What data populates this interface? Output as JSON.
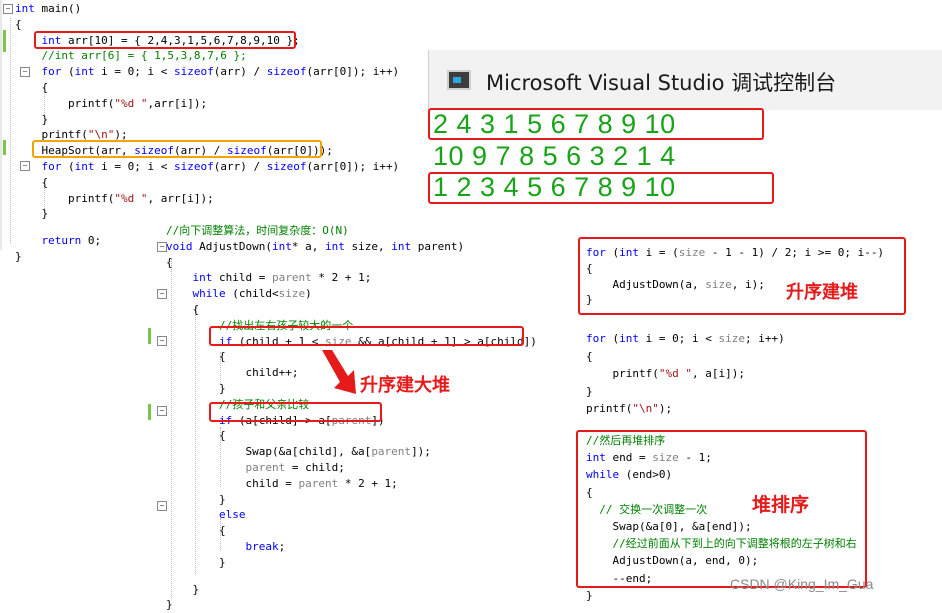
{
  "main_code": {
    "lines": [
      {
        "parts": [
          {
            "t": "int",
            "c": "kw"
          },
          {
            "t": " main()"
          }
        ]
      },
      {
        "parts": [
          {
            "t": "{"
          }
        ]
      },
      {
        "parts": [
          {
            "t": "    "
          },
          {
            "t": "int",
            "c": "kw"
          },
          {
            "t": " arr[10] = { 2,4,3,1,5,6,7,8,9,10 };"
          }
        ]
      },
      {
        "parts": [
          {
            "t": "    "
          },
          {
            "t": "//int arr[6] = { 1,5,3,8,7,6 };",
            "c": "cm"
          }
        ]
      },
      {
        "parts": [
          {
            "t": "    "
          },
          {
            "t": "for",
            "c": "kw"
          },
          {
            "t": " ("
          },
          {
            "t": "int",
            "c": "kw"
          },
          {
            "t": " i = 0; i < "
          },
          {
            "t": "sizeof",
            "c": "kw"
          },
          {
            "t": "(arr) / "
          },
          {
            "t": "sizeof",
            "c": "kw"
          },
          {
            "t": "(arr[0]); i++)"
          }
        ]
      },
      {
        "parts": [
          {
            "t": "    {"
          }
        ]
      },
      {
        "parts": [
          {
            "t": "        printf("
          },
          {
            "t": "\"%d \"",
            "c": "st"
          },
          {
            "t": ",arr[i]);"
          }
        ]
      },
      {
        "parts": [
          {
            "t": "    }"
          }
        ]
      },
      {
        "parts": [
          {
            "t": "    printf("
          },
          {
            "t": "\"\\n\"",
            "c": "st"
          },
          {
            "t": ");"
          }
        ]
      },
      {
        "parts": [
          {
            "t": "    HeapSort(arr, "
          },
          {
            "t": "sizeof",
            "c": "kw"
          },
          {
            "t": "(arr) / "
          },
          {
            "t": "sizeof",
            "c": "kw"
          },
          {
            "t": "(arr[0]));"
          }
        ]
      },
      {
        "parts": [
          {
            "t": "    "
          },
          {
            "t": "for",
            "c": "kw"
          },
          {
            "t": " ("
          },
          {
            "t": "int",
            "c": "kw"
          },
          {
            "t": " i = 0; i < "
          },
          {
            "t": "sizeof",
            "c": "kw"
          },
          {
            "t": "(arr) / "
          },
          {
            "t": "sizeof",
            "c": "kw"
          },
          {
            "t": "(arr[0]); i++)"
          }
        ]
      },
      {
        "parts": [
          {
            "t": "    {"
          }
        ]
      },
      {
        "parts": [
          {
            "t": "        printf("
          },
          {
            "t": "\"%d \"",
            "c": "st"
          },
          {
            "t": ", arr[i]);"
          }
        ]
      },
      {
        "parts": [
          {
            "t": "    }"
          }
        ]
      },
      {
        "parts": [
          {
            "t": ""
          }
        ]
      },
      {
        "parts": [
          {
            "t": "    "
          },
          {
            "t": "return",
            "c": "kw"
          },
          {
            "t": " 0;"
          }
        ]
      },
      {
        "parts": [
          {
            "t": "}"
          }
        ]
      }
    ]
  },
  "console": {
    "title": "Microsoft Visual Studio 调试控制台",
    "lines": [
      "2 4 3 1 5 6 7 8 9 10",
      "10 9 7 8 5 6 3 2 1 4",
      "1 2 3 4 5 6 7 8 9 10"
    ]
  },
  "adjust_code": {
    "lines": [
      {
        "parts": [
          {
            "t": "//向下调整算法，时间复杂度：O(N)",
            "c": "cm"
          }
        ]
      },
      {
        "parts": [
          {
            "t": "void",
            "c": "kw"
          },
          {
            "t": " AdjustDown("
          },
          {
            "t": "int",
            "c": "kw"
          },
          {
            "t": "* a, "
          },
          {
            "t": "int",
            "c": "kw"
          },
          {
            "t": " size, "
          },
          {
            "t": "int",
            "c": "kw"
          },
          {
            "t": " parent)"
          }
        ]
      },
      {
        "parts": [
          {
            "t": "{"
          }
        ]
      },
      {
        "parts": [
          {
            "t": "    "
          },
          {
            "t": "int",
            "c": "kw"
          },
          {
            "t": " child = "
          },
          {
            "t": "parent",
            "c": "pa"
          },
          {
            "t": " * 2 + 1;"
          }
        ]
      },
      {
        "parts": [
          {
            "t": "    "
          },
          {
            "t": "while",
            "c": "kw"
          },
          {
            "t": " (child<"
          },
          {
            "t": "size",
            "c": "pa"
          },
          {
            "t": ")"
          }
        ]
      },
      {
        "parts": [
          {
            "t": "    {"
          }
        ]
      },
      {
        "parts": [
          {
            "t": "        "
          },
          {
            "t": "//找出左右孩子较大的一个",
            "c": "cm"
          }
        ]
      },
      {
        "parts": [
          {
            "t": "        "
          },
          {
            "t": "if",
            "c": "kw"
          },
          {
            "t": " (child + 1 < "
          },
          {
            "t": "size",
            "c": "pa"
          },
          {
            "t": " && a[child + 1] > a[child])"
          }
        ]
      },
      {
        "parts": [
          {
            "t": "        {"
          }
        ]
      },
      {
        "parts": [
          {
            "t": "            child++;"
          }
        ]
      },
      {
        "parts": [
          {
            "t": "        }"
          }
        ]
      },
      {
        "parts": [
          {
            "t": "        "
          },
          {
            "t": "//孩子和父亲比较",
            "c": "cm"
          }
        ]
      },
      {
        "parts": [
          {
            "t": "        "
          },
          {
            "t": "if",
            "c": "kw"
          },
          {
            "t": " (a[child] > a["
          },
          {
            "t": "parent",
            "c": "pa"
          },
          {
            "t": "])"
          }
        ]
      },
      {
        "parts": [
          {
            "t": "        {"
          }
        ]
      },
      {
        "parts": [
          {
            "t": "            Swap(&a[child], &a["
          },
          {
            "t": "parent",
            "c": "pa"
          },
          {
            "t": "]);"
          }
        ]
      },
      {
        "parts": [
          {
            "t": "            "
          },
          {
            "t": "parent",
            "c": "pa"
          },
          {
            "t": " = child;"
          }
        ]
      },
      {
        "parts": [
          {
            "t": "            child = "
          },
          {
            "t": "parent",
            "c": "pa"
          },
          {
            "t": " * 2 + 1;"
          }
        ]
      },
      {
        "parts": [
          {
            "t": "        }"
          }
        ]
      },
      {
        "parts": [
          {
            "t": "        "
          },
          {
            "t": "else",
            "c": "kw"
          }
        ]
      },
      {
        "parts": [
          {
            "t": "        {"
          }
        ]
      },
      {
        "parts": [
          {
            "t": "            "
          },
          {
            "t": "break",
            "c": "kw"
          },
          {
            "t": ";"
          }
        ]
      },
      {
        "parts": [
          {
            "t": "        }"
          }
        ]
      },
      {
        "parts": [
          {
            "t": ""
          }
        ]
      },
      {
        "parts": [
          {
            "t": "    }"
          }
        ]
      },
      {
        "parts": [
          {
            "t": "}"
          }
        ]
      }
    ]
  },
  "heap_build_code": {
    "lines": [
      {
        "parts": [
          {
            "t": "for",
            "c": "kw"
          },
          {
            "t": " ("
          },
          {
            "t": "int",
            "c": "kw"
          },
          {
            "t": " i = ("
          },
          {
            "t": "size",
            "c": "pa"
          },
          {
            "t": " - 1 - 1) / 2; i >= 0; i--)"
          }
        ]
      },
      {
        "parts": [
          {
            "t": "{"
          }
        ]
      },
      {
        "parts": [
          {
            "t": "    AdjustDown(a, "
          },
          {
            "t": "size",
            "c": "pa"
          },
          {
            "t": ", i);"
          }
        ]
      },
      {
        "parts": [
          {
            "t": "}"
          }
        ]
      }
    ]
  },
  "print_code": {
    "lines": [
      {
        "parts": [
          {
            "t": "for",
            "c": "kw"
          },
          {
            "t": " ("
          },
          {
            "t": "int",
            "c": "kw"
          },
          {
            "t": " i = 0; i < "
          },
          {
            "t": "size",
            "c": "pa"
          },
          {
            "t": "; i++)"
          }
        ]
      },
      {
        "parts": [
          {
            "t": "{"
          }
        ]
      },
      {
        "parts": [
          {
            "t": "    printf("
          },
          {
            "t": "\"%d \"",
            "c": "st"
          },
          {
            "t": ", a[i]);"
          }
        ]
      },
      {
        "parts": [
          {
            "t": "}"
          }
        ]
      },
      {
        "parts": [
          {
            "t": "printf("
          },
          {
            "t": "\"\\n\"",
            "c": "st"
          },
          {
            "t": ");"
          }
        ]
      }
    ]
  },
  "sort_code": {
    "lines": [
      {
        "parts": [
          {
            "t": "//然后再堆排序",
            "c": "cm"
          }
        ]
      },
      {
        "parts": [
          {
            "t": "int",
            "c": "kw"
          },
          {
            "t": " end = "
          },
          {
            "t": "size",
            "c": "pa"
          },
          {
            "t": " - 1;"
          }
        ]
      },
      {
        "parts": [
          {
            "t": "while",
            "c": "kw"
          },
          {
            "t": " (end>0)"
          }
        ]
      },
      {
        "parts": [
          {
            "t": "{"
          }
        ]
      },
      {
        "parts": [
          {
            "t": "  "
          },
          {
            "t": "// 交换一次调整一次",
            "c": "cm"
          }
        ]
      },
      {
        "parts": [
          {
            "t": "    Swap(&a[0], &a[end]);"
          }
        ]
      },
      {
        "parts": [
          {
            "t": "    "
          },
          {
            "t": "//经过前面从下到上的向下调整将根的左子树和右",
            "c": "cm"
          }
        ]
      },
      {
        "parts": [
          {
            "t": "    AdjustDown(a, end, 0);"
          }
        ]
      },
      {
        "parts": [
          {
            "t": "    --end;"
          }
        ]
      },
      {
        "parts": [
          {
            "t": "}"
          }
        ]
      }
    ]
  },
  "annotations": {
    "max_heap": "升序建大堆",
    "build_ascending": "升序建堆",
    "heap_sort": "堆排序"
  },
  "watermark": "CSDN @King_Im_Gua"
}
